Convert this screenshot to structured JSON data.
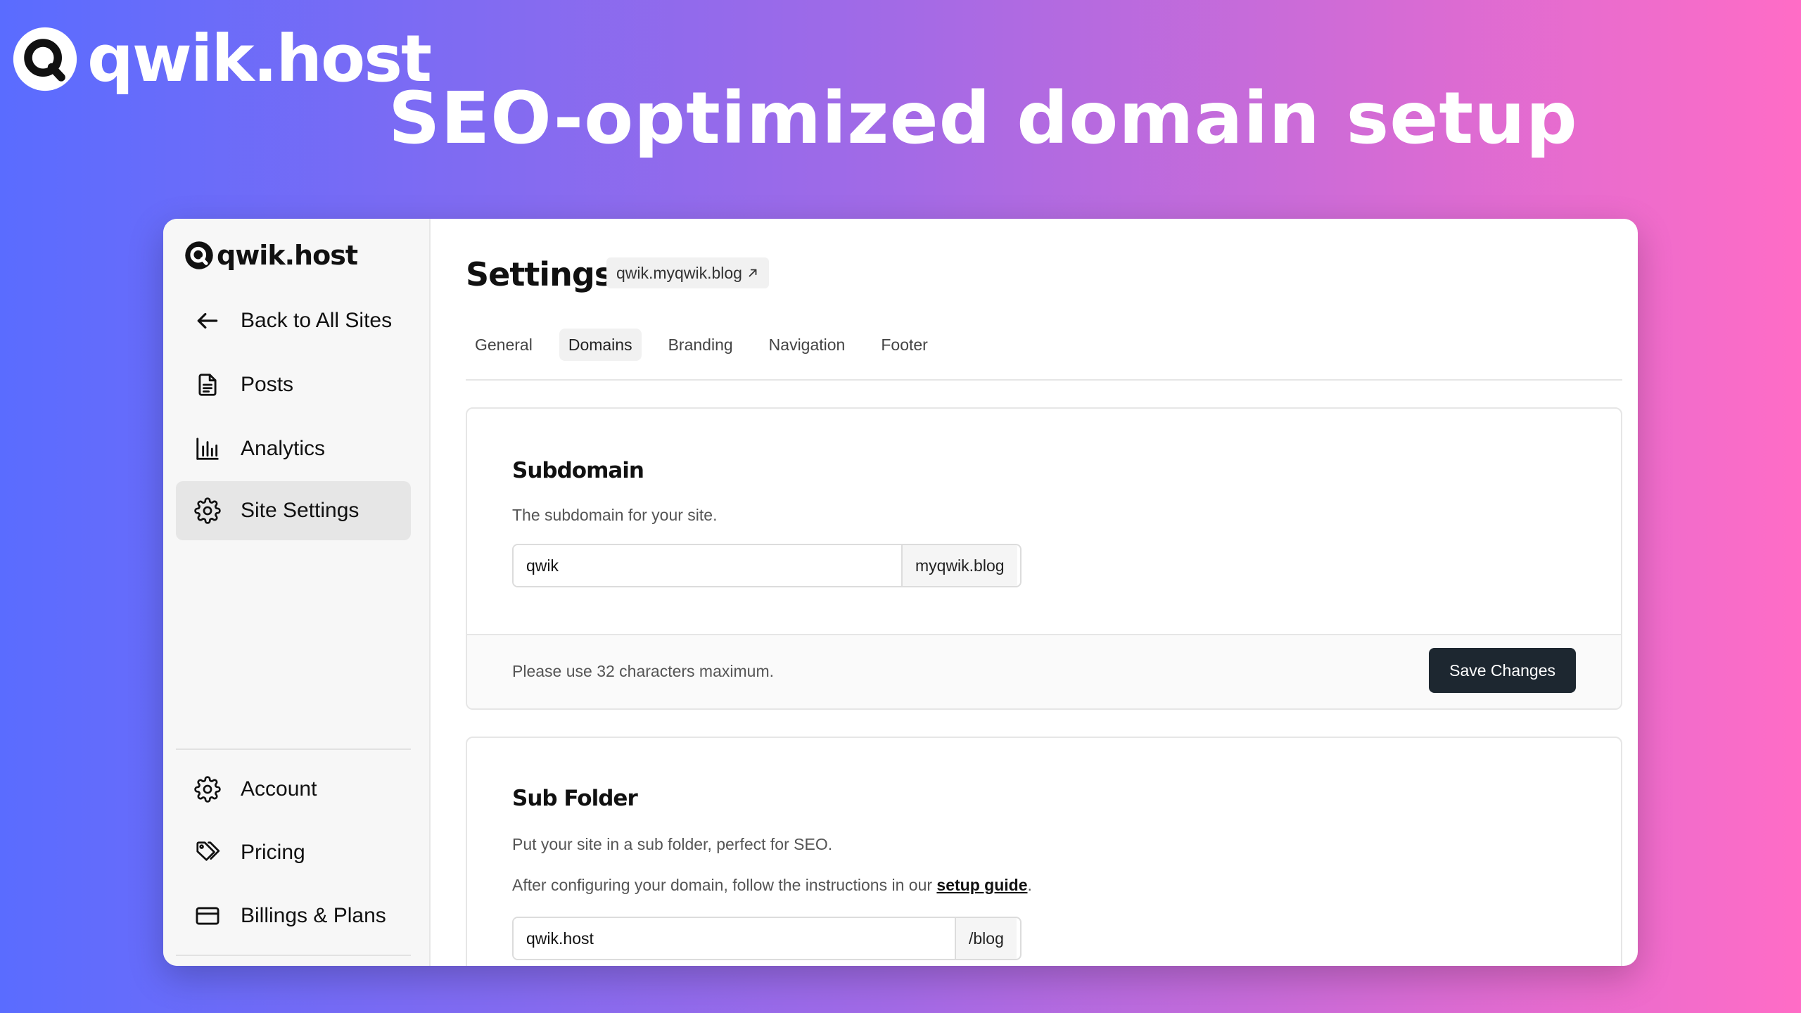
{
  "banner": {
    "brand_name": "qwik.host",
    "headline": "SEO-optimized domain setup"
  },
  "sidebar": {
    "logo_text": "qwik.host",
    "items": [
      {
        "label": "Back to All Sites",
        "icon": "arrow-left-icon"
      },
      {
        "label": "Posts",
        "icon": "document-icon"
      },
      {
        "label": "Analytics",
        "icon": "bar-chart-icon"
      },
      {
        "label": "Site Settings",
        "icon": "gear-icon",
        "active": true
      }
    ],
    "bottom_items": [
      {
        "label": "Account",
        "icon": "gear-icon"
      },
      {
        "label": "Pricing",
        "icon": "tags-icon"
      },
      {
        "label": "Billings & Plans",
        "icon": "credit-card-icon"
      }
    ]
  },
  "header": {
    "title": "Settings",
    "site_link": "qwik.myqwik.blog"
  },
  "tabs": [
    {
      "label": "General"
    },
    {
      "label": "Domains",
      "active": true
    },
    {
      "label": "Branding"
    },
    {
      "label": "Navigation"
    },
    {
      "label": "Footer"
    }
  ],
  "subdomain_card": {
    "title": "Subdomain",
    "description": "The subdomain for your site.",
    "input_value": "qwik",
    "suffix": "myqwik.blog",
    "footer_note": "Please use 32 characters maximum.",
    "save_label": "Save Changes"
  },
  "subfolder_card": {
    "title": "Sub Folder",
    "description": "Put your site in a sub folder, perfect for SEO.",
    "guide_prefix": "After configuring your domain, follow the instructions in our ",
    "guide_link": "setup guide",
    "guide_suffix": ".",
    "input_value": "qwik.host",
    "suffix": "/blog"
  },
  "colors": {
    "accent_dark": "#1d2730",
    "gradient_left": "#5a6cff",
    "gradient_right": "#ff6cc6"
  }
}
